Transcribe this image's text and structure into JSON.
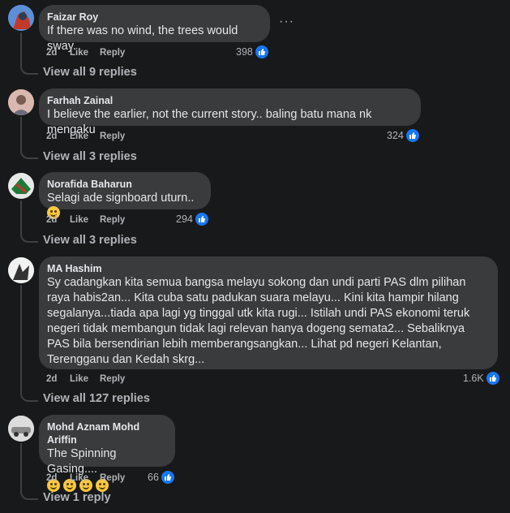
{
  "comments": [
    {
      "author": "Faizar Roy",
      "text": "If there was no wind, the trees would sway.",
      "time": "2d",
      "like": "Like",
      "reply": "Reply",
      "count": "398",
      "view_replies": "View all 9 replies",
      "more_icon": "ellipsis-icon",
      "avatar_color": "#3b6fb6"
    },
    {
      "author": "Farhah Zainal",
      "text": "I believe the earlier, not the current story.. baling batu mana nk mengaku",
      "time": "2d",
      "like": "Like",
      "reply": "Reply",
      "count": "324",
      "view_replies": "View all 3 replies",
      "avatar_color": "#b88c8c"
    },
    {
      "author": "Norafida Baharun",
      "text": "Selagi ade signboard uturn..",
      "time": "2d",
      "like": "Like",
      "reply": "Reply",
      "count": "294",
      "view_replies": "View all 3 replies",
      "avatar_color": "#3f6b4a"
    },
    {
      "author": "MA Hashim",
      "text": "Sy cadangkan kita semua bangsa melayu sokong dan undi parti PAS dlm pilihan raya habis2an... Kita cuba satu padukan suara melayu... Kini kita hampir hilang segalanya...tiada apa lagi yg tinggal utk kita rugi... Istilah undi PAS ekonomi teruk negeri tidak membangun tidak lagi relevan hanya dogeng semata2... Sebaliknya PAS bila bersendirian lebih memberangsangkan... Lihat pd negeri Kelantan, Terengganu dan Kedah skrg...",
      "time": "2d",
      "like": "Like",
      "reply": "Reply",
      "count": "1.6K",
      "view_replies": "View all 127 replies",
      "avatar_color": "#9a9a9a"
    },
    {
      "author": "Mohd Aznam Mohd Ariffin",
      "text": "The Spinning Gasing....",
      "time": "2d",
      "like": "Like",
      "reply": "Reply",
      "count": "66",
      "view_replies": "View 1 reply",
      "avatar_color": "#c8c8c8"
    }
  ],
  "colors": {
    "background": "#18191a",
    "bubble": "#3a3b3c",
    "like_blue": "#1877f2",
    "secondary_text": "#b0b3b8"
  }
}
